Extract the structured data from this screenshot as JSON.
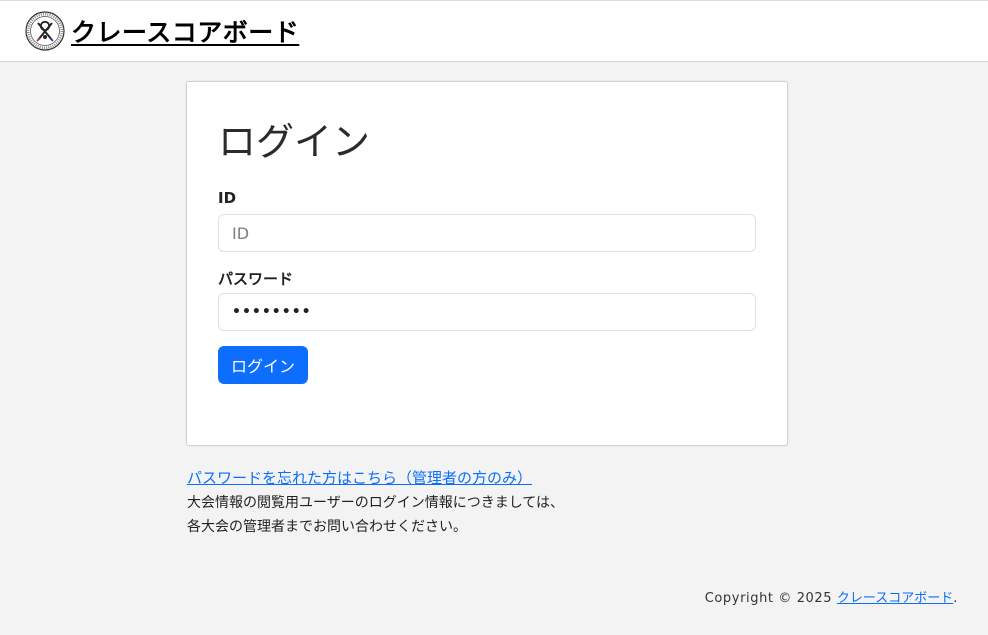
{
  "header": {
    "brand_name": "クレースコアボード",
    "logo_icon": "club-emblem-icon"
  },
  "login_card": {
    "title": "ログイン",
    "id_label": "ID",
    "id_placeholder": "ID",
    "id_value": "",
    "password_label": "パスワード",
    "password_value": "••••••••",
    "submit_label": "ログイン"
  },
  "help": {
    "forgot_link": "パスワードを忘れた方はこちら（管理者の方のみ）",
    "line1": "大会情報の閲覧用ユーザーのログイン情報につきましては、",
    "line2": "各大会の管理者までお問い合わせください。"
  },
  "footer": {
    "copyright_prefix": "Copyright © 2025 ",
    "site_link": "クレースコアボード",
    "suffix": "."
  },
  "colors": {
    "primary": "#0d6efd",
    "background": "#f3f3f3",
    "card": "#ffffff"
  }
}
